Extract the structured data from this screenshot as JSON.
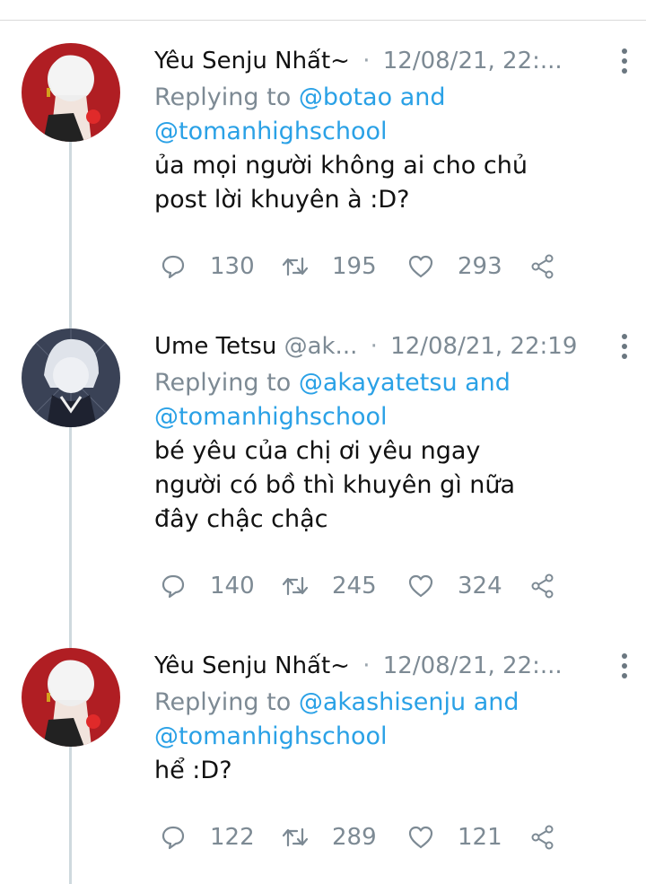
{
  "tweets": [
    {
      "name": "Yêu Senju Nhất~",
      "handle": "",
      "time": "12/08/21, 22:...",
      "reply_prefix": "Replying to",
      "reply_links_line1": "@botao and",
      "reply_links_line2": "@tomanhighschool",
      "text_lines": [
        "ủa mọi người không ai cho chủ",
        "post lời khuyên à :D?"
      ],
      "replies": "130",
      "retweets": "195",
      "likes": "293",
      "avatar": "red-haired-character"
    },
    {
      "name": "Ume Tetsu",
      "handle": "@ak...",
      "time": "12/08/21, 22:19",
      "reply_prefix": "Replying to",
      "reply_links_line1": "@akayatetsu and",
      "reply_links_line2": "@tomanhighschool",
      "text_lines": [
        "bé yêu của chị ơi yêu ngay",
        "người có bồ thì khuyên gì nữa",
        "đây chậc chậc"
      ],
      "replies": "140",
      "retweets": "245",
      "likes": "324",
      "avatar": "silver-haired-character"
    },
    {
      "name": "Yêu Senju Nhất~",
      "handle": "",
      "time": "12/08/21, 22:...",
      "reply_prefix": "Replying to",
      "reply_links_line1": "@akashisenju and",
      "reply_links_line2": "@tomanhighschool",
      "text_lines": [
        "hể :D?"
      ],
      "replies": "122",
      "retweets": "289",
      "likes": "121",
      "avatar": "red-haired-character"
    }
  ],
  "colors": {
    "link": "#2aa1e6",
    "muted": "#7d8a94",
    "thread": "#cfd9de"
  }
}
